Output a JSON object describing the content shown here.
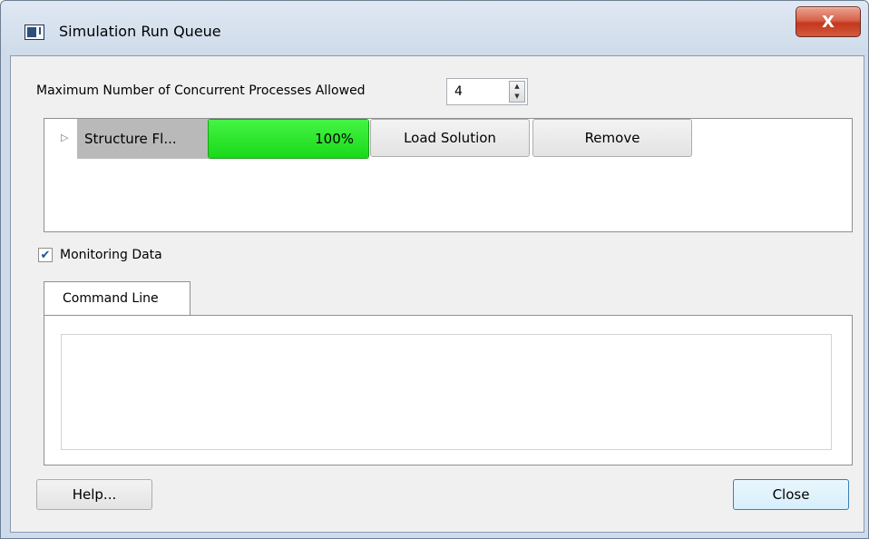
{
  "window": {
    "title": "Simulation Run Queue",
    "close_glyph": "X"
  },
  "settings": {
    "max_processes_label": "Maximum Number of Concurrent Processes Allowed",
    "max_processes_value": "4",
    "spin_up_glyph": "▲",
    "spin_down_glyph": "▼"
  },
  "queue": {
    "jobs": [
      {
        "expander_glyph": "▷",
        "name": "Structure Fl...",
        "progress_percent": 100,
        "progress_label": "100%",
        "load_label": "Load Solution",
        "remove_label": "Remove"
      }
    ]
  },
  "monitoring": {
    "checked": true,
    "check_glyph": "✔",
    "label": "Monitoring Data"
  },
  "tabs": [
    {
      "label": "Command Line",
      "active": true
    }
  ],
  "command_line": {
    "text": ""
  },
  "footer": {
    "help_label": "Help...",
    "close_label": "Close"
  },
  "colors": {
    "progress_green": "#22e022",
    "title_close_red": "#c4381c"
  }
}
